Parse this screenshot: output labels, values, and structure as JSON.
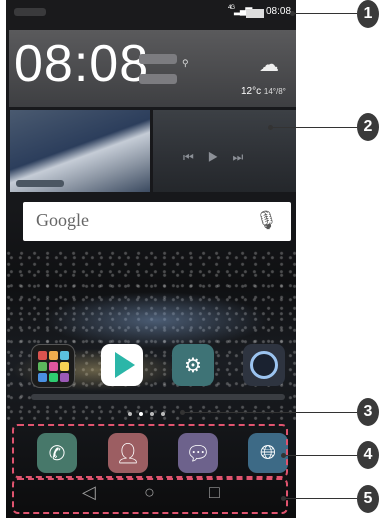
{
  "status_bar": {
    "network": "4G",
    "time": "08:08"
  },
  "clock_widget": {
    "time": "08:08",
    "temperature": "12°c",
    "temp_range": "14°/8°"
  },
  "search": {
    "label": "Google"
  },
  "home_apps": [
    {
      "name": "folder"
    },
    {
      "name": "play-store"
    },
    {
      "name": "settings"
    },
    {
      "name": "camera"
    }
  ],
  "dock": [
    {
      "name": "phone"
    },
    {
      "name": "contacts"
    },
    {
      "name": "messaging"
    },
    {
      "name": "browser"
    }
  ],
  "nav_bar": {
    "back": "◁",
    "home": "○",
    "recent": "□"
  },
  "callouts": [
    "1",
    "2",
    "3",
    "4",
    "5"
  ],
  "colors": {
    "highlight": "#e0546f",
    "badge": "#3a3a3a"
  }
}
